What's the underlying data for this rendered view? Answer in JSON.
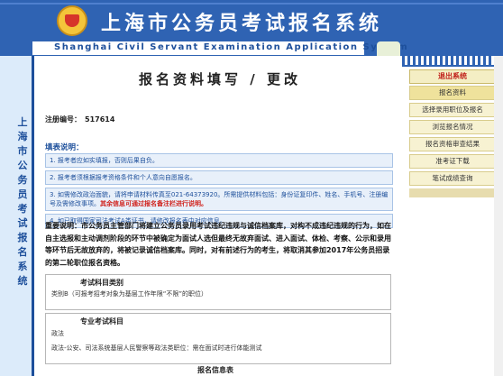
{
  "header": {
    "title": "上海市公务员考试报名系统",
    "subtitle": "Shanghai Civil Servant Examination Application System"
  },
  "leftbar": {
    "vertical_text": "上海市公务员考试报名系统"
  },
  "page": {
    "title": "报名资料填写 / 更改",
    "registration_label": "注册编号：",
    "registration_number": "517614",
    "fill_instructions_title": "填表说明："
  },
  "notes": [
    {
      "text": "1. 报考者应如实填报，否则后果自负。"
    },
    {
      "text": "2. 报考者须根据报考资格条件和个人意向自愿报名。"
    },
    {
      "text": "3. 如需修改政治面貌，请将申请材料传真至021-64373920。所需提供材料包括：身份证复印件、姓名、手机号、注册编号及需修改事项。",
      "red": "其余信息可通过报名备注栏进行说明。"
    },
    {
      "text": "4. 如已取得国家司法考试A类证书，请修改报名表中对应信息。"
    }
  ],
  "important_notice": "重要说明：市公务员主管部门将建立公务员录用考试违纪违规与诚信档案库，对构不成违纪违规的行为，如在自主选报和主动调剂阶段的环节中被确定为面试人选但最终无故弃面试、进入面试、体检、考察、公示和录用等环节后无故放弃的，将被记录诚信档案库。同时，对有前述行为的考生，将取消其参加2017年公务员招录的第二轮职位报名资格。",
  "sections": {
    "exam_subject_category_title": "考试科目类别",
    "exam_subject_category_value": "类别B（可报考招考对象为基层工作年限“不限”的职位）",
    "professional_subject_title": "专业考试科目",
    "professional_subject_value": "政法",
    "professional_subject_note": "政法-公安、司法系统基层人民警察等政法类职位：需在面试时进行体能测试",
    "bottom_title": "报名信息表"
  },
  "nav": {
    "exit": "退出系统",
    "items": [
      {
        "label": "报名资料",
        "active": true
      },
      {
        "label": "选择录用职位及报名",
        "active": false
      },
      {
        "label": "浏览报名情况",
        "active": false
      },
      {
        "label": "报名资格审查结果",
        "active": false
      },
      {
        "label": "准考证下载",
        "active": false
      },
      {
        "label": "笔试成绩查询",
        "active": false
      }
    ]
  }
}
